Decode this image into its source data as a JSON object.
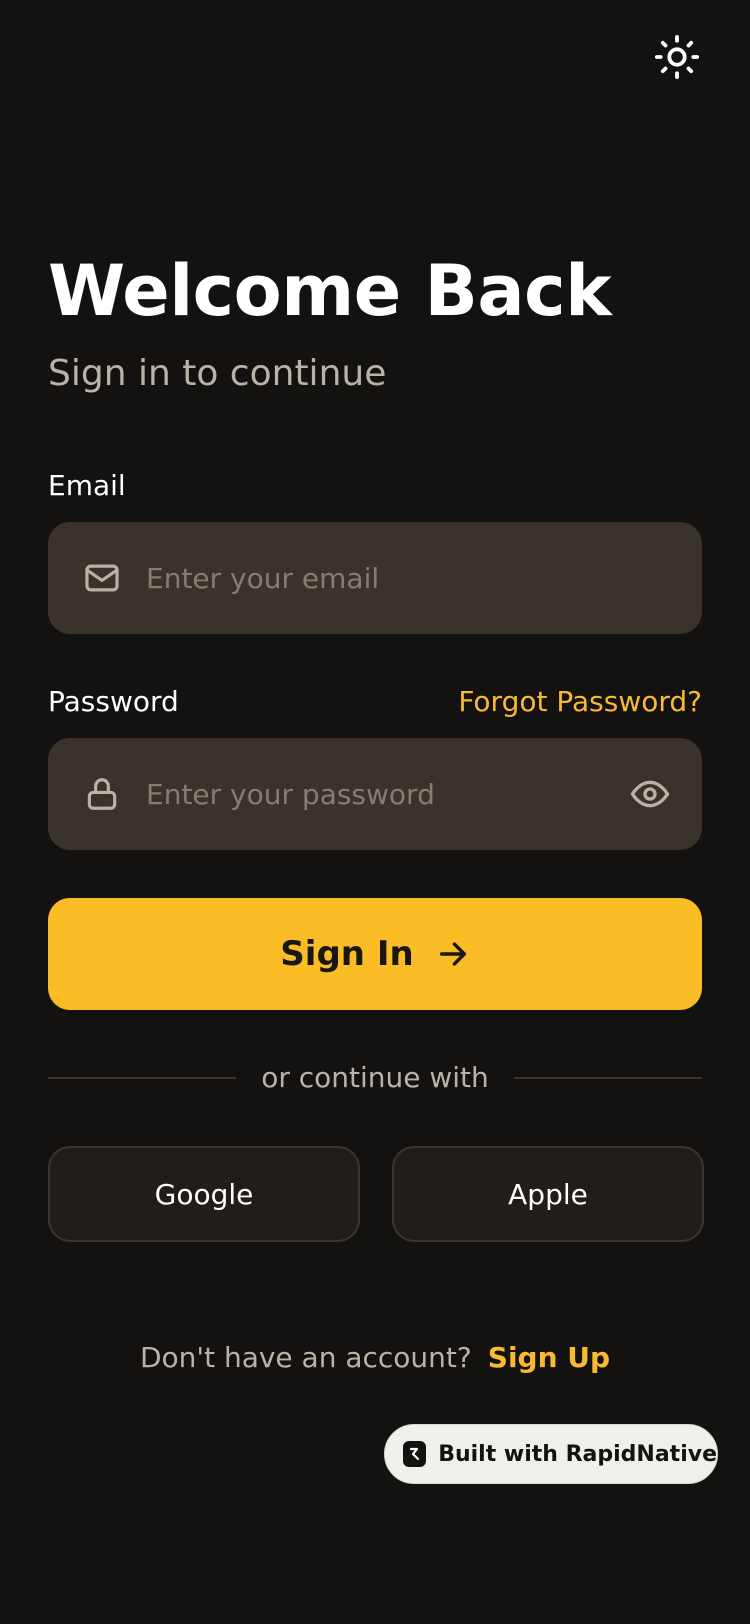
{
  "header": {
    "theme_toggle_icon": "sun-icon"
  },
  "hero": {
    "title": "Welcome Back",
    "subtitle": "Sign in to continue"
  },
  "form": {
    "email": {
      "label": "Email",
      "placeholder": "Enter your email",
      "value": "",
      "icon": "mail-icon"
    },
    "password": {
      "label": "Password",
      "placeholder": "Enter your password",
      "value": "",
      "icon": "lock-icon",
      "toggle_icon": "eye-icon",
      "forgot_label": "Forgot Password?"
    },
    "submit_label": "Sign In",
    "submit_icon": "arrow-right-icon"
  },
  "social": {
    "divider_text": "or continue with",
    "google_label": "Google",
    "apple_label": "Apple"
  },
  "footer": {
    "prompt": "Don't have an account?",
    "signup_label": "Sign Up"
  },
  "badge": {
    "label": "Built with RapidNative",
    "icon": "rapidnative-logo-icon"
  },
  "colors": {
    "background": "#141210",
    "accent": "#fbbd26",
    "link": "#f9b931",
    "field_bg": "#3a332b",
    "muted_text": "#b9b2a6"
  }
}
